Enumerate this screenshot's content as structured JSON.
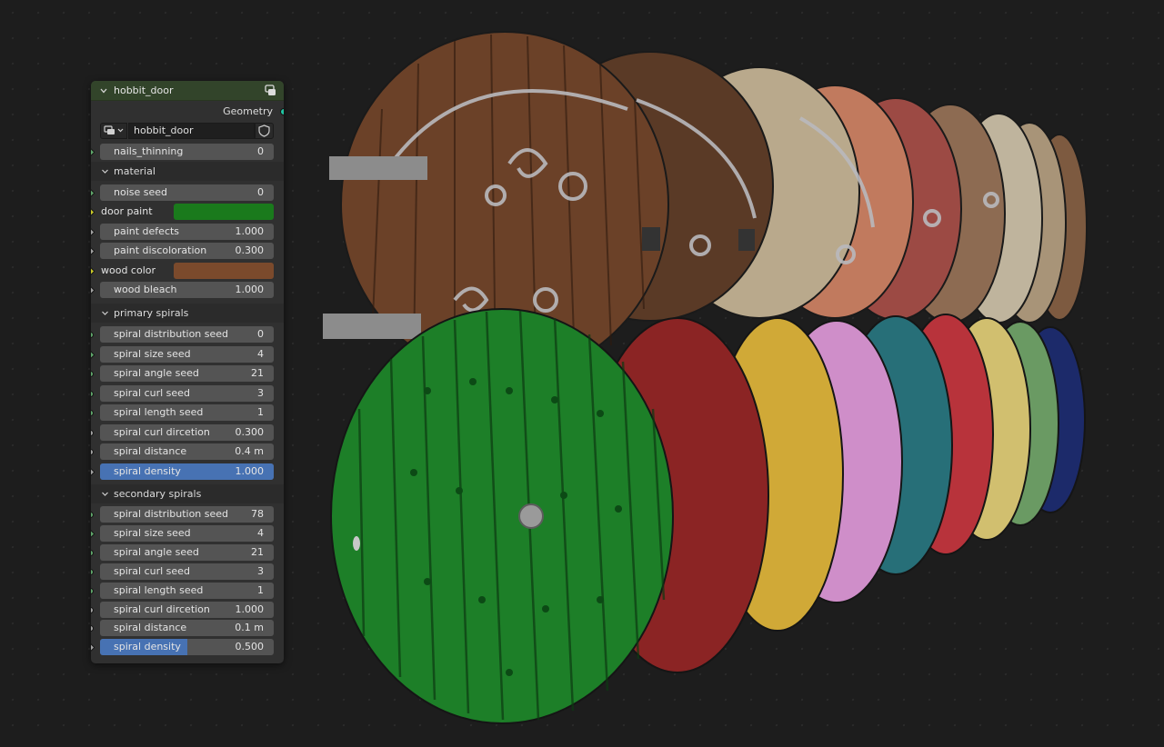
{
  "colors": {
    "node_bg": "#303030",
    "header_bg": "#32442a",
    "slider_fill": "#4772b3",
    "field_bg": "#545454",
    "socket_green": "#5fa56a",
    "socket_grey": "#a1a1a1",
    "socket_yellow": "#c7c729",
    "geometry_socket": "#21c5a2"
  },
  "node": {
    "title": "hobbit_door",
    "output_label": "Geometry",
    "node_group_name": "hobbit_door",
    "nails_thinning": {
      "label": "nails_thinning",
      "value": "0"
    },
    "material": {
      "label": "material",
      "noise_seed": {
        "label": "noise seed",
        "value": "0"
      },
      "door_paint": {
        "label": "door paint",
        "color": "#1a7a1c"
      },
      "paint_defects": {
        "label": "paint defects",
        "value": "1.000"
      },
      "paint_discoloration": {
        "label": "paint discoloration",
        "value": "0.300"
      },
      "wood_color": {
        "label": "wood color",
        "color": "#7b4a2c"
      },
      "wood_bleach": {
        "label": "wood bleach",
        "value": "1.000"
      }
    },
    "primary_spirals": {
      "label": "primary spirals",
      "rows": [
        {
          "label": "spiral distribution seed",
          "value": "0"
        },
        {
          "label": "spiral size seed",
          "value": "4"
        },
        {
          "label": "spiral angle seed",
          "value": "21"
        },
        {
          "label": "spiral curl seed",
          "value": "3"
        },
        {
          "label": "spiral length seed",
          "value": "1"
        },
        {
          "label": "spiral curl dircetion",
          "value": "0.300"
        },
        {
          "label": "spiral distance",
          "value": "0.4 m"
        },
        {
          "label": "spiral density",
          "value": "1.000",
          "fraction": 1.0
        }
      ]
    },
    "secondary_spirals": {
      "label": "secondary spirals",
      "rows": [
        {
          "label": "spiral distribution seed",
          "value": "78"
        },
        {
          "label": "spiral size seed",
          "value": "4"
        },
        {
          "label": "spiral angle seed",
          "value": "21"
        },
        {
          "label": "spiral curl seed",
          "value": "3"
        },
        {
          "label": "spiral length seed",
          "value": "1"
        },
        {
          "label": "spiral curl dircetion",
          "value": "1.000"
        },
        {
          "label": "spiral distance",
          "value": "0.1 m"
        },
        {
          "label": "spiral density",
          "value": "0.500",
          "fraction": 0.5
        }
      ]
    }
  },
  "viewport": {
    "back_doors": [
      "#6b4128",
      "#5a3a26",
      "#b9a98c",
      "#c17a5e",
      "#9c4a44",
      "#8d6b52",
      "#bfb49d",
      "#a89478",
      "#7d5a40"
    ],
    "front_doors": [
      "#1d7f28",
      "#8b2424",
      "#d0a937",
      "#cf8ec9",
      "#276f78",
      "#b8333b",
      "#d1bf6f",
      "#6a9a63",
      "#1c2a6a"
    ]
  }
}
